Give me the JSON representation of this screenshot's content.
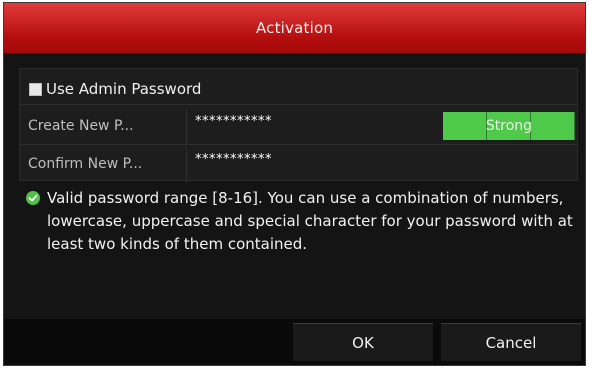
{
  "dialog": {
    "title": "Activation"
  },
  "admin_password": {
    "label": "Use Admin Password",
    "checked": false
  },
  "fields": {
    "create": {
      "label": "Create New P...",
      "value": "***********"
    },
    "confirm": {
      "label": "Confirm New P...",
      "value": "***********"
    }
  },
  "strength": {
    "label": "Strong",
    "level": 3,
    "max_level": 3,
    "color": "#4ec94a"
  },
  "info": {
    "icon": "check-circle-icon",
    "text": "Valid password range [8-16]. You can use a combination of numbers, lowercase, uppercase and special character for your password with at least two kinds of them contained."
  },
  "buttons": {
    "ok_label": "OK",
    "cancel_label": "Cancel"
  },
  "colors": {
    "title_bar": "#c01818",
    "background": "#141414",
    "check_icon": "#4fc048"
  }
}
